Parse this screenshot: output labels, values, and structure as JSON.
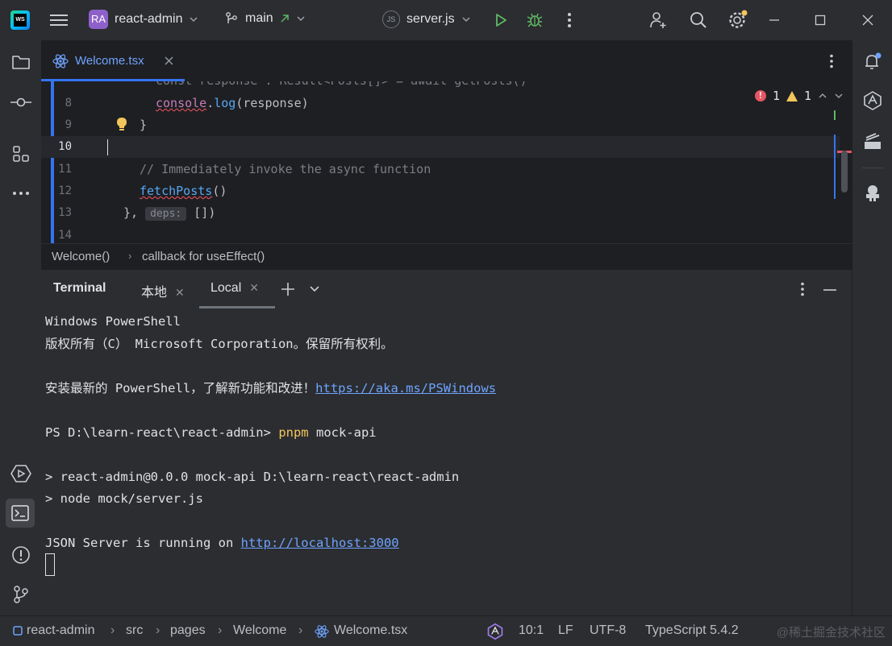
{
  "titlebar": {
    "project_badge": "RA",
    "project_name": "react-admin",
    "branch": "main",
    "run_config": "server.js"
  },
  "editor_tab": {
    "label": "Welcome.tsx"
  },
  "editor": {
    "top_partial": "const response : Result<Posts[]> = await getPosts()",
    "lines": [
      {
        "num": "8",
        "text_obj": "console",
        "text_dot": ".",
        "text_fn": "log",
        "text_rest": "(response)"
      },
      {
        "num": "9",
        "text": "}"
      },
      {
        "num": "10",
        "text": ""
      },
      {
        "num": "11",
        "text": "// Immediately invoke the async function"
      },
      {
        "num": "12",
        "text_fn": "fetchPosts",
        "text_rest": "()"
      },
      {
        "num": "13",
        "text_pre": "},",
        "hint": "deps:",
        "text_rest": "[])"
      },
      {
        "num": "14",
        "text": ""
      }
    ],
    "problems": {
      "errors": "1",
      "warnings": "1"
    }
  },
  "breadcrumb": {
    "item1": "Welcome()",
    "item2": "callback for useEffect()"
  },
  "terminal": {
    "title": "Terminal",
    "tabs": [
      {
        "label": "本地"
      },
      {
        "label": "Local"
      }
    ],
    "lines": {
      "l1": "Windows PowerShell",
      "l2": "版权所有（C） Microsoft Corporation。保留所有权利。",
      "l3_pre": "安装最新的 PowerShell，了解新功能和改进！",
      "l3_link": "https://aka.ms/PSWindows",
      "l4_prompt": "PS D:\\learn-react\\react-admin>",
      "l4_cmd": "pnpm",
      "l4_args": "mock-api",
      "l5": "> react-admin@0.0.0 mock-api D:\\learn-react\\react-admin",
      "l6": "> node mock/server.js",
      "l7_pre": "JSON Server is running on",
      "l7_link": "http://localhost:3000"
    }
  },
  "statusbar": {
    "path": [
      "react-admin",
      "src",
      "pages",
      "Welcome",
      "Welcome.tsx"
    ],
    "position": "10:1",
    "line_sep": "LF",
    "encoding": "UTF-8",
    "language": "TypeScript 5.4.2",
    "watermark": "@稀土掘金技术社区"
  },
  "colors": {
    "accent": "#3574f0",
    "error": "#e55765",
    "warning": "#f2c55c",
    "run_green": "#5fb865"
  },
  "icons": [
    "hamburger-menu-icon",
    "branch-icon",
    "run-icon",
    "debug-icon",
    "more-vertical-icon",
    "add-user-icon",
    "search-icon",
    "settings-icon",
    "minimize-icon",
    "maximize-icon",
    "close-icon",
    "folder-icon",
    "commit-icon",
    "structure-icon",
    "more-horizontal-icon",
    "services-icon",
    "terminal-icon",
    "problems-icon",
    "git-icon",
    "notifications-icon",
    "ai-assistant-icon",
    "database-icon",
    "plugin-icon",
    "react-icon",
    "lightbulb-icon"
  ]
}
